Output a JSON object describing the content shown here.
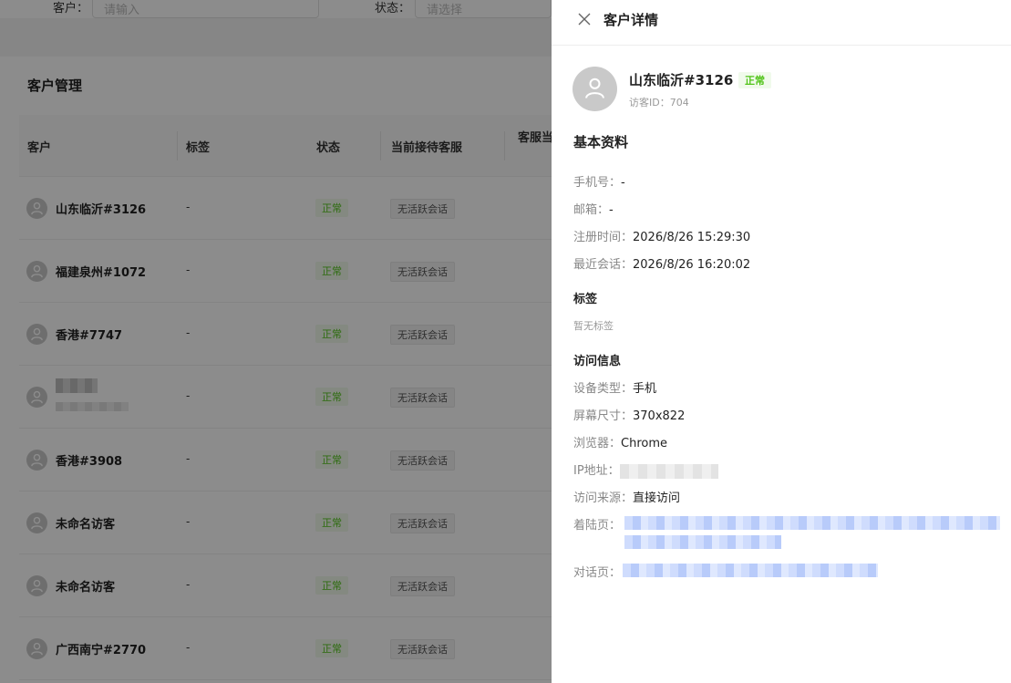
{
  "filters": {
    "customer_label": "客户：",
    "customer_placeholder": "请输入",
    "status_label": "状态：",
    "status_placeholder": "请选择"
  },
  "page": {
    "title": "客户管理"
  },
  "table": {
    "headers": [
      "客户",
      "标签",
      "状态",
      "当前接待客服",
      "客服当"
    ],
    "rows": [
      {
        "name": "山东临沂#3126",
        "tags": "-",
        "status": "正常",
        "session": "无活跃会话"
      },
      {
        "name": "福建泉州#1072",
        "tags": "-",
        "status": "正常",
        "session": "无活跃会话"
      },
      {
        "name": "香港#7747",
        "tags": "-",
        "status": "正常",
        "session": "无活跃会话"
      },
      {
        "name": "",
        "tags": "-",
        "status": "正常",
        "session": "无活跃会话"
      },
      {
        "name": "香港#3908",
        "tags": "-",
        "status": "正常",
        "session": "无活跃会话"
      },
      {
        "name": "未命名访客",
        "tags": "-",
        "status": "正常",
        "session": "无活跃会话"
      },
      {
        "name": "未命名访客",
        "tags": "-",
        "status": "正常",
        "session": "无活跃会话"
      },
      {
        "name": "广西南宁#2770",
        "tags": "-",
        "status": "正常",
        "session": "无活跃会话"
      }
    ]
  },
  "drawer": {
    "title": "客户详情",
    "close_icon": "close-icon",
    "profile": {
      "name": "山东临沂#3126",
      "status": "正常",
      "visitor_id": "访客ID：704"
    },
    "basic": {
      "title": "基本资料",
      "phone_label": "手机号：",
      "phone_value": "-",
      "email_label": "邮箱：",
      "email_value": "-",
      "registered_label": "注册时间：",
      "registered_value": "2026/8/26 15:29:30",
      "last_session_label": "最近会话：",
      "last_session_value": "2026/8/26 16:20:02"
    },
    "tags": {
      "title": "标签",
      "empty": "暂无标签"
    },
    "visit": {
      "title": "访问信息",
      "device_label": "设备类型：",
      "device_value": "手机",
      "screen_label": "屏幕尺寸：",
      "screen_value": "370x822",
      "browser_label": "浏览器：",
      "browser_value": "Chrome",
      "ip_label": "IP地址：",
      "source_label": "访问来源：",
      "source_value": "直接访问",
      "landing_label": "着陆页：",
      "chat_page_label": "对话页："
    }
  },
  "colors": {
    "success": "#52c41a",
    "success_bg": "#f0faeb",
    "overlay": "rgba(0,0,0,0.45)",
    "link_blur": "#b8cbfa"
  }
}
